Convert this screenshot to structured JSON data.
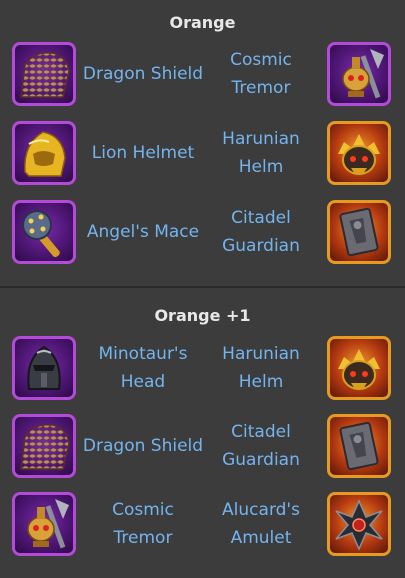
{
  "sections": [
    {
      "title": "Orange",
      "rows": [
        {
          "left_item": "Dragon Shield",
          "left_icon": "dragon-shield-icon",
          "right_item": "Cosmic Tremor",
          "right_icon": "cosmic-tremor-icon"
        },
        {
          "left_item": "Lion Helmet",
          "left_icon": "lion-helmet-icon",
          "right_item": "Harunian Helm",
          "right_icon": "harunian-helm-icon"
        },
        {
          "left_item": "Angel's Mace",
          "left_icon": "angels-mace-icon",
          "right_item": "Citadel Guardian",
          "right_icon": "citadel-guardian-icon"
        }
      ]
    },
    {
      "title": "Orange +1",
      "rows": [
        {
          "left_item": "Minotaur's Head",
          "left_icon": "minotaurs-head-icon",
          "right_item": "Harunian Helm",
          "right_icon": "harunian-helm-icon"
        },
        {
          "left_item": "Dragon Shield",
          "left_icon": "dragon-shield-icon",
          "right_item": "Citadel Guardian",
          "right_icon": "citadel-guardian-icon"
        },
        {
          "left_item": "Cosmic Tremor",
          "left_icon": "cosmic-tremor-icon",
          "right_item": "Alucard's Amulet",
          "right_icon": "alucards-amulet-icon"
        }
      ]
    }
  ],
  "colors": {
    "background": "#3c3c3c",
    "item_text": "#74b4ee",
    "title_text": "#e8e8e8",
    "purple_frame": "#b44ad8",
    "gold_frame": "#e59a21"
  }
}
